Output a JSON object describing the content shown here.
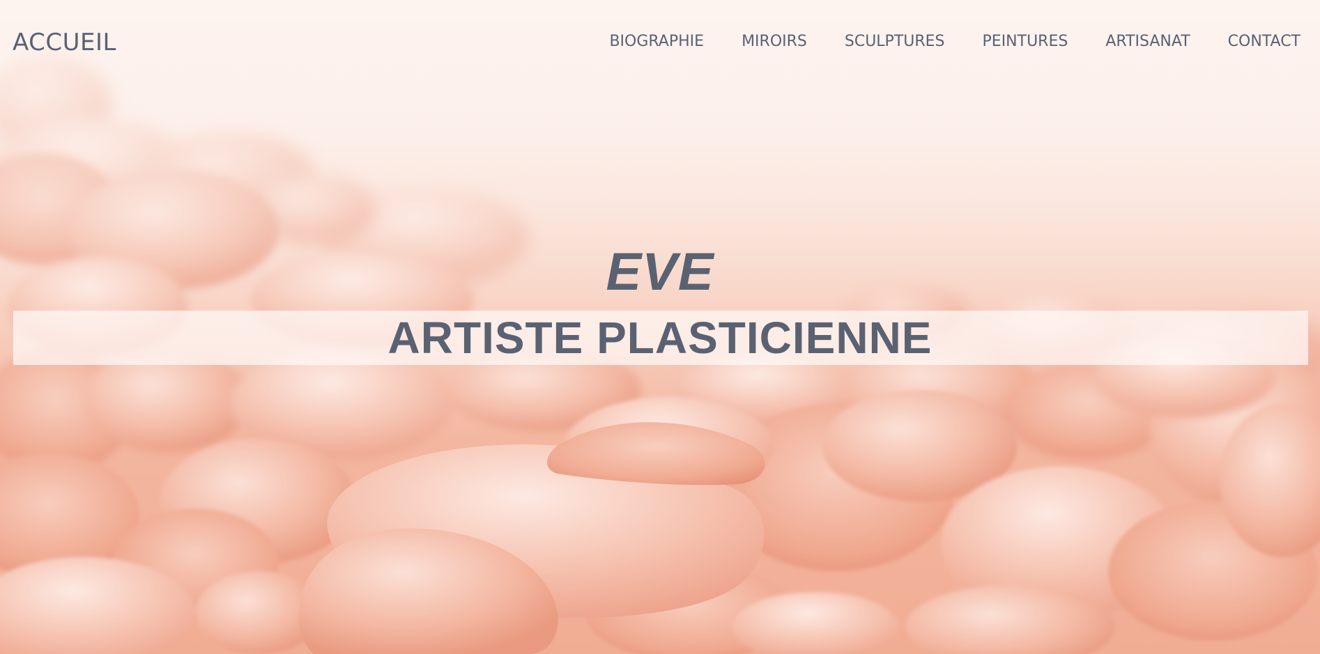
{
  "header": {
    "brand": "ACCUEIL",
    "nav": [
      {
        "label": "BIOGRAPHIE"
      },
      {
        "label": "MIROIRS"
      },
      {
        "label": "SCULPTURES"
      },
      {
        "label": "PEINTURES"
      },
      {
        "label": "ARTISANAT"
      },
      {
        "label": "CONTACT"
      }
    ]
  },
  "hero": {
    "name": "EVE",
    "subtitle": "ARTISTE PLASTICIENNE",
    "background": "pebbles-photo",
    "tint_color": "#f3b4a0",
    "text_color": "#5a6272"
  }
}
